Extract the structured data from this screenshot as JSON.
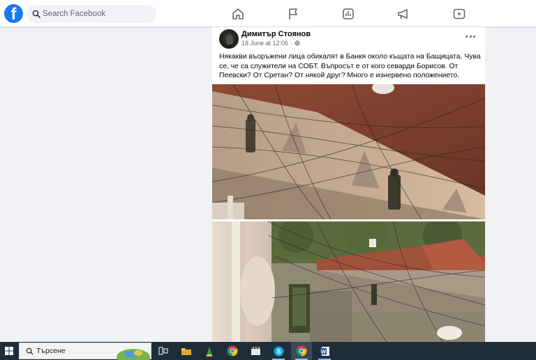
{
  "topbar": {
    "logo_letter": "f",
    "search_placeholder": "Search Facebook",
    "nav_icons": [
      "home-icon",
      "flag-icon",
      "chart-icon",
      "megaphone-icon",
      "video-icon"
    ]
  },
  "post": {
    "author": "Димитър Стоянов",
    "timestamp": "18 June at 12:06",
    "separator": "·",
    "privacy_icon": "globe-icon",
    "text": "Някакви въоръжени лица обикалят в Банкя около къщата на Бащицата. Чува се, че са служители на СОБТ. Въпросът е от кого севарди Борисов. От Пеевски? От Сретан? От някой друг? Много е изнервено положението."
  },
  "taskbar": {
    "search_placeholder": "Търсене",
    "apps": [
      "task-view-icon",
      "file-explorer-icon",
      "app-icon",
      "chrome-icon",
      "media-app-icon",
      "skype-icon",
      "chrome-icon",
      "word-icon"
    ]
  },
  "colors": {
    "brand": "#1877f2",
    "page_background": "#f0f2f5",
    "taskbar": "#1f2d3a"
  }
}
